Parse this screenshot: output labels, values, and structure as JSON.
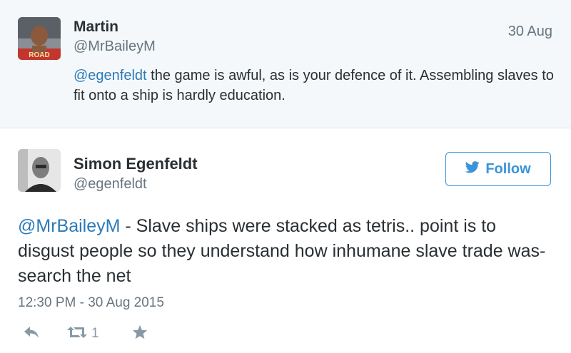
{
  "reply": {
    "name": "Martin",
    "handle": "@MrBaileyM",
    "time": "30 Aug",
    "mention": "@egenfeldt",
    "text": " the game is awful, as is your defence of it. Assembling slaves to fit onto a ship is hardly education."
  },
  "tweet": {
    "name": "Simon Egenfeldt",
    "handle": "@egenfeldt",
    "follow_label": "Follow",
    "mention": "@MrBaileyM",
    "text": " - Slave ships were stacked as tetris.. point is to disgust people so they understand how inhumane slave trade was- search the net",
    "timestamp": "12:30 PM - 30 Aug 2015",
    "retweet_count": "1"
  },
  "colors": {
    "link": "#2b7bb9",
    "follow": "#3b94d9",
    "muted": "#66757f",
    "reply_bg": "#f5f8fa"
  },
  "icons": [
    "reply-icon",
    "retweet-icon",
    "favorite-icon",
    "twitter-bird-icon"
  ]
}
